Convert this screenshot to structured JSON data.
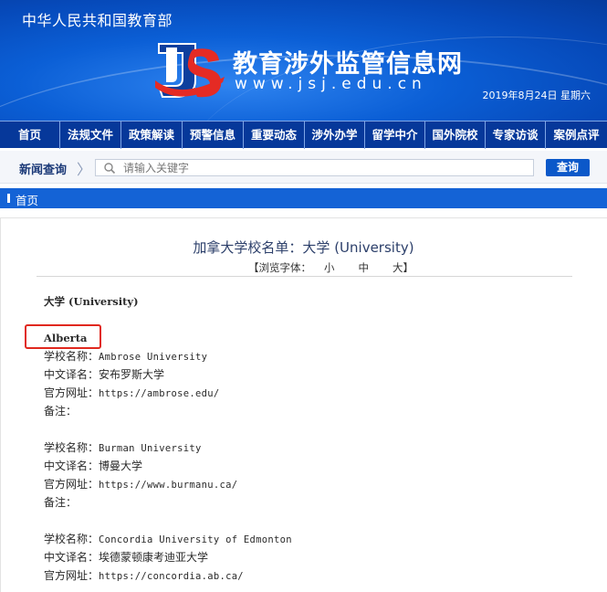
{
  "header": {
    "ministry": "中华人民共和国教育部",
    "site_name": "教育涉外监管信息网",
    "site_domain": "www.jsj.edu.cn",
    "date": "2019年8月24日 星期六",
    "logo_icon": "jsj-logo-icon"
  },
  "nav": {
    "items": [
      {
        "label": "首页"
      },
      {
        "label": "法规文件"
      },
      {
        "label": "政策解读"
      },
      {
        "label": "预警信息"
      },
      {
        "label": "重要动态"
      },
      {
        "label": "涉外办学"
      },
      {
        "label": "留学中介"
      },
      {
        "label": "国外院校"
      },
      {
        "label": "专家访谈"
      },
      {
        "label": "案例点评"
      }
    ]
  },
  "search": {
    "label": "新闻查询",
    "placeholder": "请输入关键字",
    "value": "",
    "button": "查询"
  },
  "breadcrumb": {
    "home": "首页"
  },
  "article": {
    "title": "加拿大学校名单：大学 (University)",
    "font_bar": {
      "prefix": "【浏览字体：",
      "small": "小",
      "medium": "中",
      "large": "大",
      "suffix": "】"
    },
    "section_heading": "大学 (University)",
    "province": "Alberta",
    "labels": {
      "name": "学校名称：",
      "cn_name": "中文译名：",
      "url": "官方网址：",
      "note": "备注："
    },
    "schools": [
      {
        "name": "Ambrose University",
        "cn_name": "安布罗斯大学",
        "url": "https://ambrose.edu/",
        "note": ""
      },
      {
        "name": "Burman University",
        "cn_name": "博曼大学",
        "url": "https://www.burmanu.ca/",
        "note": ""
      },
      {
        "name": "Concordia University of Edmonton",
        "cn_name": "埃德蒙顿康考迪亚大学",
        "url": "https://concordia.ab.ca/",
        "note": ""
      }
    ]
  },
  "colors": {
    "banner_blue": "#0b5fd6",
    "nav_navy": "#06389a",
    "crumb_blue": "#1463d6",
    "highlight_red": "#e0281e"
  }
}
